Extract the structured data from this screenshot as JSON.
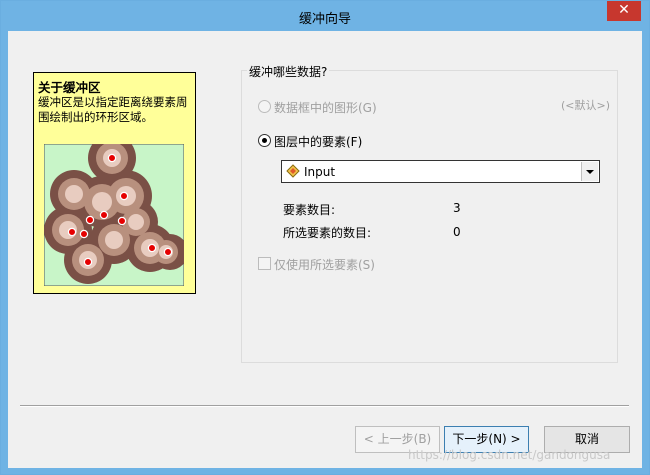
{
  "window": {
    "title": "缓冲向导",
    "close_glyph": "✕"
  },
  "info": {
    "title": "关于缓冲区",
    "description": "缓冲区是以指定距离绕要素周围绘制出的环形区域。"
  },
  "question": "缓冲哪些数据?",
  "option_graphics": {
    "label": "数据框中的图形(G)",
    "default_hint": "(<默认>)"
  },
  "option_layer": {
    "label": "图层中的要素(F)",
    "selected_layer": "Input"
  },
  "stats": {
    "feature_count_label": "要素数目:",
    "feature_count": "3",
    "selected_count_label": "所选要素的数目:",
    "selected_count": "0"
  },
  "use_selected": {
    "label": "仅使用所选要素(S)"
  },
  "buttons": {
    "back": "< 上一步(B)",
    "next": "下一步(N) >",
    "cancel": "取消"
  },
  "watermark": "https://blog.csdn.net/gandongusa",
  "colors": {
    "titlebar": "#6fb3e4",
    "close": "#c7372e",
    "info_bg": "#ffff99"
  }
}
